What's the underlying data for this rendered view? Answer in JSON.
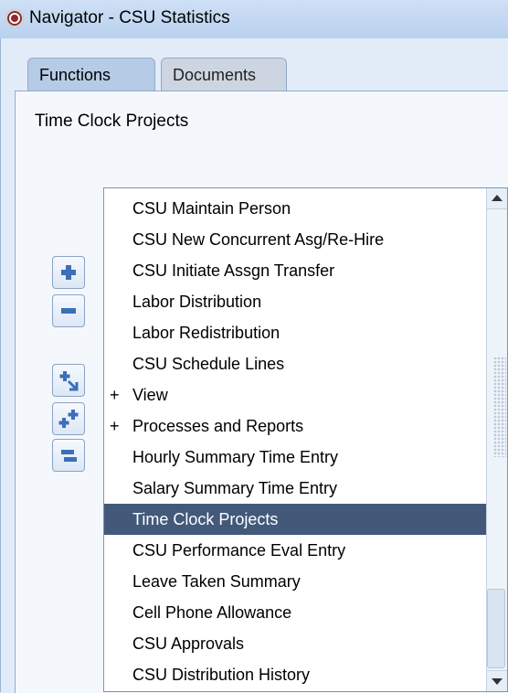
{
  "window": {
    "title": "Navigator - CSU Statistics"
  },
  "tabs": [
    {
      "label": "Functions",
      "active": true
    },
    {
      "label": "Documents",
      "active": false
    }
  ],
  "panel": {
    "title": "Time Clock Projects"
  },
  "list": {
    "items": [
      {
        "prefix": "",
        "label": "CSU Maintain Person"
      },
      {
        "prefix": "",
        "label": "CSU New Concurrent Asg/Re-Hire"
      },
      {
        "prefix": "",
        "label": "CSU Initiate Assgn Transfer"
      },
      {
        "prefix": "",
        "label": "Labor Distribution"
      },
      {
        "prefix": "",
        "label": "Labor Redistribution"
      },
      {
        "prefix": "",
        "label": "CSU Schedule Lines"
      },
      {
        "prefix": "+",
        "label": "View"
      },
      {
        "prefix": "+",
        "label": "Processes and Reports"
      },
      {
        "prefix": "",
        "label": "Hourly Summary Time Entry"
      },
      {
        "prefix": "",
        "label": "Salary Summary Time Entry"
      },
      {
        "prefix": "",
        "label": "Time Clock Projects",
        "selected": true
      },
      {
        "prefix": "",
        "label": "CSU Performance Eval Entry"
      },
      {
        "prefix": "",
        "label": "Leave Taken Summary"
      },
      {
        "prefix": "",
        "label": "Cell Phone Allowance"
      },
      {
        "prefix": "",
        "label": "CSU Approvals"
      },
      {
        "prefix": "",
        "label": "CSU Distribution History"
      }
    ]
  },
  "toolbar": {
    "buttons": [
      {
        "name": "expand-button",
        "icon": "plus-icon"
      },
      {
        "name": "collapse-button",
        "icon": "minus-icon"
      },
      {
        "name": "expand-branch-button",
        "icon": "expand-branch-icon"
      },
      {
        "name": "expand-all-button",
        "icon": "expand-all-icon"
      },
      {
        "name": "collapse-all-button",
        "icon": "collapse-all-icon"
      }
    ]
  },
  "colors": {
    "selection": "#42597a",
    "accent": "#3b6fb6"
  }
}
